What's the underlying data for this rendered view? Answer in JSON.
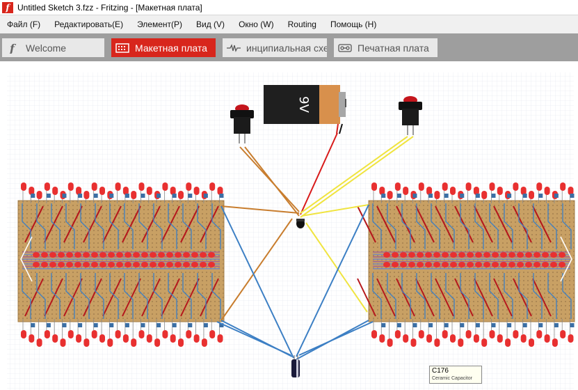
{
  "window": {
    "title": "Untitled Sketch 3.fzz - Fritzing - [Макетная плата]",
    "icon": "fritzing-app-icon"
  },
  "menu": [
    "Файл (F)",
    "Редактировать(E)",
    "Элемент(P)",
    "Вид (V)",
    "Окно (W)",
    "Routing",
    "Помощь (H)"
  ],
  "tabs": [
    {
      "label": "Welcome",
      "icon": "welcome-icon",
      "active": false
    },
    {
      "label": "Макетная плата",
      "icon": "breadboard-icon",
      "active": true
    },
    {
      "label": "инципиальная схе",
      "icon": "schematic-icon",
      "active": false
    },
    {
      "label": "Печатная плата",
      "icon": "pcb-icon",
      "active": false
    }
  ],
  "battery": {
    "label": "9V"
  },
  "tooltip": {
    "name": "C176",
    "description": "Ceramic Capacitor"
  },
  "colors": {
    "accent": "#d8261c",
    "board": "#c8a064",
    "grid": "#d6dde6",
    "wire_orange": "#c87d2e",
    "wire_blue": "#3c7fc4",
    "wire_red": "#d81a1a",
    "wire_yellow": "#f0e440",
    "led": "#e83030"
  }
}
